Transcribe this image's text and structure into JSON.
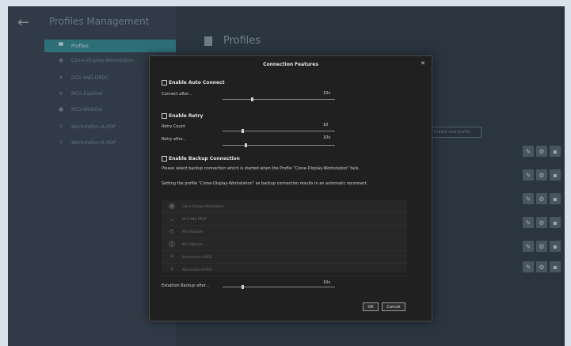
{
  "app": {
    "title": "Profiles Management",
    "back_icon": "arrow-left-icon"
  },
  "sidebar": {
    "items": [
      {
        "label": "Profiles",
        "icon": "profile-icon",
        "glyph": "▀",
        "active": true
      },
      {
        "label": "Clone-Display-Workstation",
        "icon": "eye-icon",
        "glyph": "◉",
        "active": false
      },
      {
        "label": "DCS AND DRDC",
        "icon": "chevron-down-icon",
        "glyph": "▾",
        "active": false
      },
      {
        "label": "MCS-Explorer",
        "icon": "explorer-icon",
        "glyph": "e",
        "active": false
      },
      {
        "label": "MCS-Website",
        "icon": "globe-icon",
        "glyph": "●",
        "active": false
      },
      {
        "label": "Workstation-A-RDP",
        "icon": "rdp-icon",
        "glyph": "⚡",
        "active": false
      },
      {
        "label": "Workstation-B-RDP",
        "icon": "rdp-icon",
        "glyph": "⚡",
        "active": false
      }
    ]
  },
  "main": {
    "title": "Profiles",
    "create_button": "Create new profile",
    "row_count": 6
  },
  "modal": {
    "title": "Connection Features",
    "auto_connect": {
      "label": "Enable Auto Connect",
      "connect_after_label": "Connect after...",
      "connect_after_value": "10s"
    },
    "retry": {
      "label": "Enable Retry",
      "count_label": "Retry Count",
      "count_value": "10",
      "after_label": "Retry after...",
      "after_value": "10s"
    },
    "backup": {
      "label": "Enable Backup Connection",
      "desc1": "Please select backup connection which is started when the Profile \"Clone-Display-Workstation\" fails.",
      "desc2": "Setting the profile \"Clone-Display-Workstation\" as backup connection results in an automatic reconnect.",
      "items": [
        {
          "label": "Clone-Display-Workstation",
          "icon": "eye-icon",
          "glyph": "◉"
        },
        {
          "label": "DCS AND DRDC",
          "icon": "chevron-down-icon",
          "glyph": "⌄"
        },
        {
          "label": "MCS-Explorer",
          "icon": "explorer-icon",
          "glyph": "e"
        },
        {
          "label": "MCS-Website",
          "icon": "globe-icon",
          "glyph": "◍"
        },
        {
          "label": "Workstation-A-RDP",
          "icon": "rdp-icon",
          "glyph": "⚡"
        },
        {
          "label": "Workstation-B-RDP",
          "icon": "rdp-icon",
          "glyph": "⚡"
        }
      ],
      "establish_label": "Establish Backup after...",
      "establish_value": "10s"
    },
    "ok_label": "OK",
    "cancel_label": "Cancel"
  },
  "colors": {
    "sidebar_active": "#3a8f99",
    "modal_bg": "#202020",
    "app_bg": "#374654"
  }
}
